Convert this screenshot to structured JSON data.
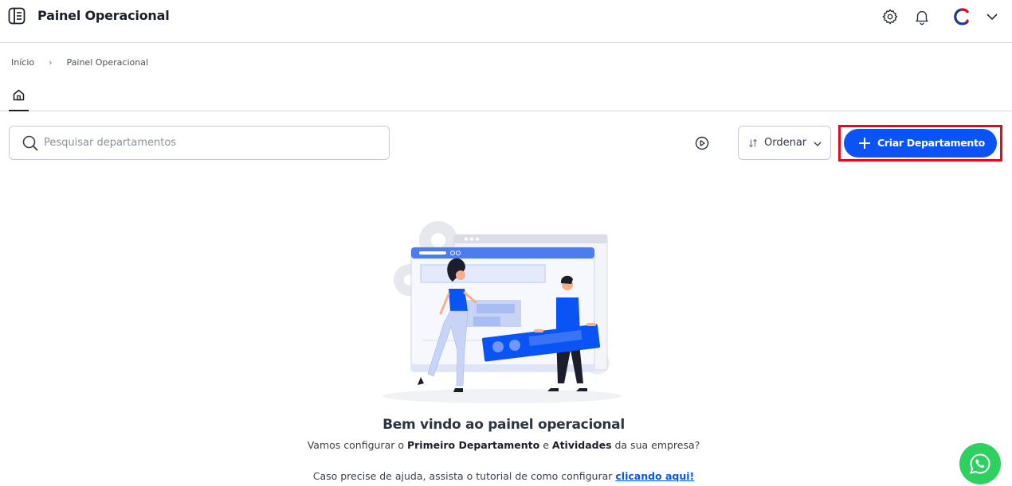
{
  "header": {
    "title": "Painel Operacional",
    "icons": [
      "menu-book-icon",
      "gear-icon",
      "bell-icon",
      "user-avatar",
      "chevron-down-icon"
    ]
  },
  "breadcrumb": {
    "items": [
      "Início",
      "Painel Operacional"
    ]
  },
  "tabs": [
    {
      "icon": "home-icon",
      "active": true
    }
  ],
  "toolbar": {
    "search_placeholder": "Pesquisar departamentos",
    "search_value": "",
    "play_icon": "play-circle-icon",
    "sort_label": "Ordenar",
    "create_label": "Criar Departamento"
  },
  "welcome": {
    "title": "Bem vindo ao painel operacional",
    "sub_prefix": "Vamos configurar o ",
    "sub_bold1": "Primeiro Departamento",
    "sub_mid": " e ",
    "sub_bold2": "Atividades",
    "sub_suffix": " da sua empresa?",
    "help_prefix": "Caso precise de ajuda, assista o tutorial de como configurar ",
    "help_link": "clicando aqui!"
  },
  "colors": {
    "primary": "#0a54f5",
    "highlight_border": "#e3081b",
    "whatsapp": "#2ed15f",
    "text_dark": "#1c1f2b"
  }
}
